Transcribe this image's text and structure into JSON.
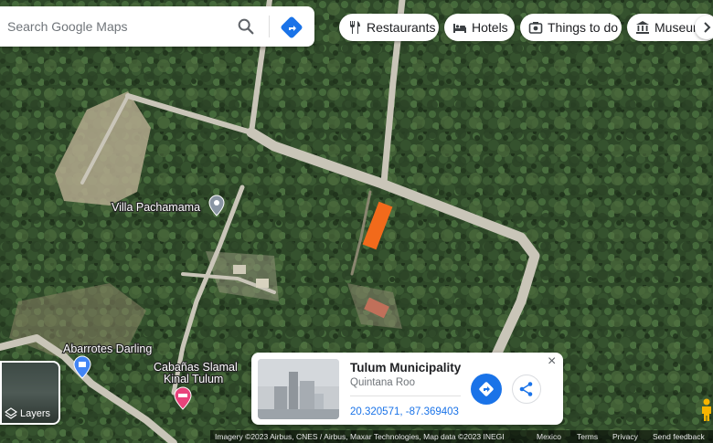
{
  "search": {
    "placeholder": "Search Google Maps"
  },
  "categories": [
    {
      "label": "Restaurants",
      "icon": "fork-knife-icon"
    },
    {
      "label": "Hotels",
      "icon": "bed-icon"
    },
    {
      "label": "Things to do",
      "icon": "camera-icon"
    },
    {
      "label": "Museum",
      "icon": "museum-icon"
    }
  ],
  "map": {
    "places": [
      {
        "name": "Villa Pachamama",
        "icon": "pin-icon"
      },
      {
        "name": "Abarrotes Darling",
        "icon": "shopping-bag-pin-icon"
      },
      {
        "name_line1": "Cabañas Slamal",
        "name_line2": "Kinal Tulum",
        "icon": "hotel-pin-icon",
        "color": "#e8437b"
      }
    ],
    "highlight_color": "#f26a1b",
    "road_color": "#c9c5b8"
  },
  "layers": {
    "label": "Layers"
  },
  "place_card": {
    "title": "Tulum Municipality",
    "subtitle": "Quintana Roo",
    "coordinates": "20.320571, -87.369403",
    "close_symbol": "×"
  },
  "footer": {
    "attribution": "Imagery ©2023 Airbus, CNES / Airbus, Maxar Technologies, Map data ©2023 INEGI",
    "region": "Mexico",
    "terms": "Terms",
    "privacy": "Privacy",
    "feedback": "Send feedback"
  },
  "colors": {
    "accent_blue": "#1a73e8",
    "forest": "#2f4a2a"
  }
}
